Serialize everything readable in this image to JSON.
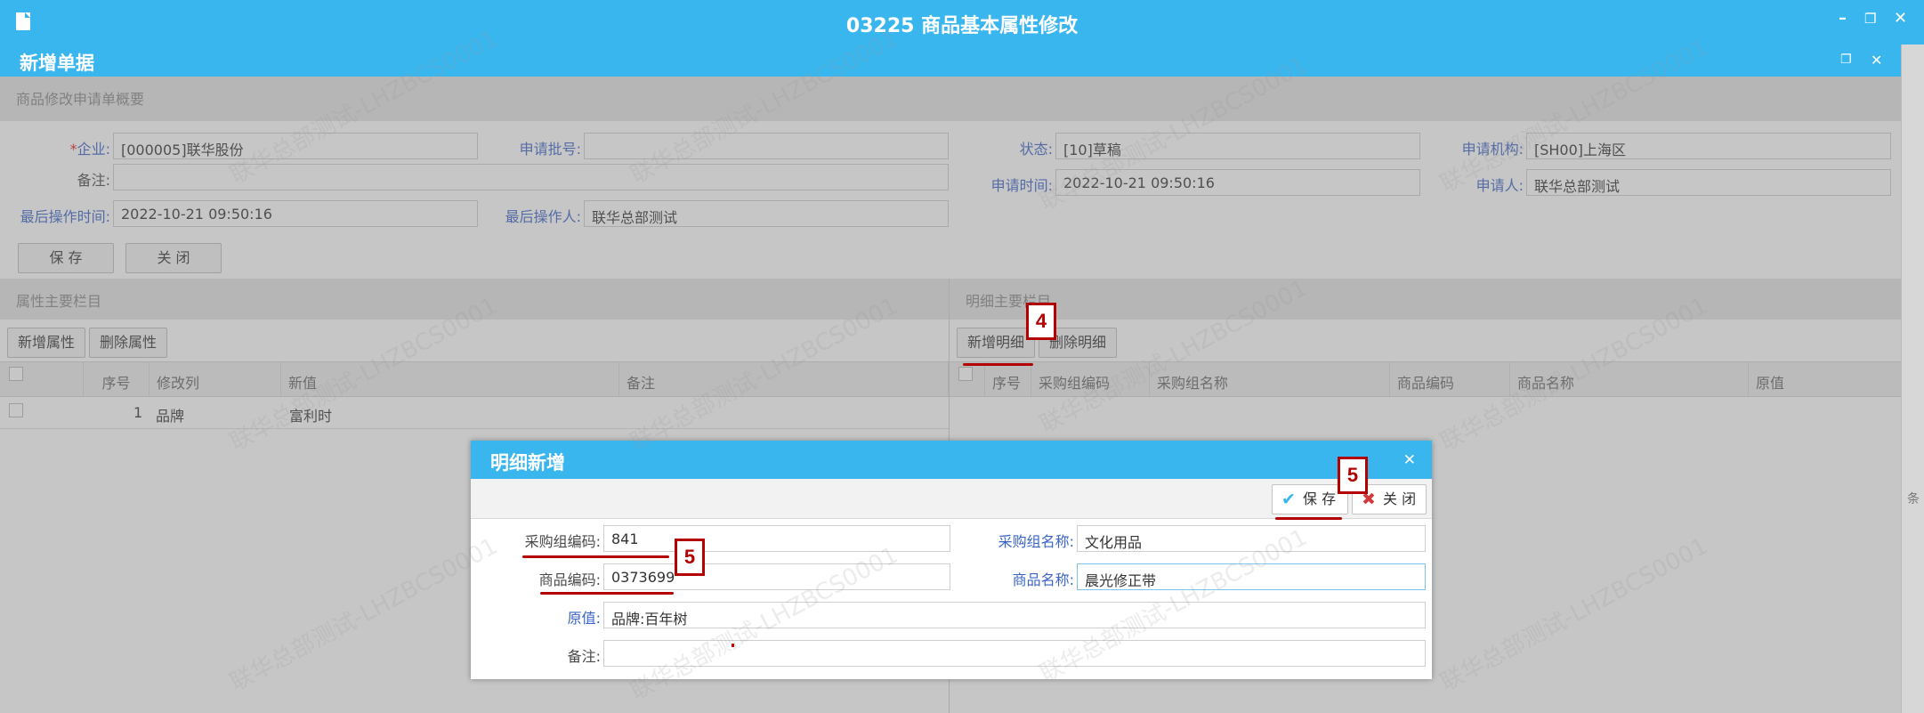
{
  "app": {
    "title": "03225 商品基本属性修改"
  },
  "window": {
    "title": "新增单据"
  },
  "summary": {
    "header": "商品修改申请单概要",
    "fields": {
      "enterprise_label": "企业:",
      "enterprise_req": "*",
      "enterprise_value": "[000005]联华股份",
      "batch_label": "申请批号:",
      "batch_value": "",
      "status_label": "状态:",
      "status_value": "[10]草稿",
      "org_label": "申请机构:",
      "org_value": "[SH00]上海区",
      "remark_label": "备注:",
      "remark_value": "",
      "apply_time_label": "申请时间:",
      "apply_time_value": "2022-10-21 09:50:16",
      "applicant_label": "申请人:",
      "applicant_value": "联华总部测试",
      "last_op_time_label": "最后操作时间:",
      "last_op_time_value": "2022-10-21 09:50:16",
      "last_operator_label": "最后操作人:",
      "last_operator_value": "联华总部测试"
    },
    "buttons": {
      "save": "保 存",
      "close": "关 闭"
    }
  },
  "attributes": {
    "header": "属性主要栏目",
    "buttons": {
      "add": "新增属性",
      "delete": "删除属性"
    },
    "columns": [
      "序号",
      "修改列",
      "新值",
      "备注"
    ],
    "rows": [
      {
        "seq": "1",
        "column": "品牌",
        "new_value": "富利时",
        "remark": ""
      }
    ]
  },
  "details": {
    "header": "明细主要栏目",
    "buttons": {
      "add": "新增明细",
      "delete": "删除明细"
    },
    "columns": [
      "序号",
      "采购组编码",
      "采购组名称",
      "商品编码",
      "商品名称",
      "原值"
    ]
  },
  "dialog": {
    "title": "明细新增",
    "buttons": {
      "save": "保 存",
      "close": "关 闭"
    },
    "fields": {
      "group_code_label": "采购组编码:",
      "group_code_value": "841",
      "group_name_label": "采购组名称:",
      "group_name_value": "文化用品",
      "product_code_label": "商品编码:",
      "product_code_value": "0373699",
      "product_name_label": "商品名称:",
      "product_name_value": "晨光修正带",
      "original_label": "原值:",
      "original_value": "品牌:百年树",
      "remark_label": "备注:",
      "remark_value": ""
    }
  },
  "annotations": {
    "marker_4": "4",
    "marker_5a": "5",
    "marker_5b": "5"
  },
  "watermark": "联华总部测试-LHZBCS0001",
  "side_text": "条",
  "colors": {
    "titlebar": "#3ab6ef",
    "label_blue": "#3b64c8",
    "annotation_red": "#b30000"
  }
}
